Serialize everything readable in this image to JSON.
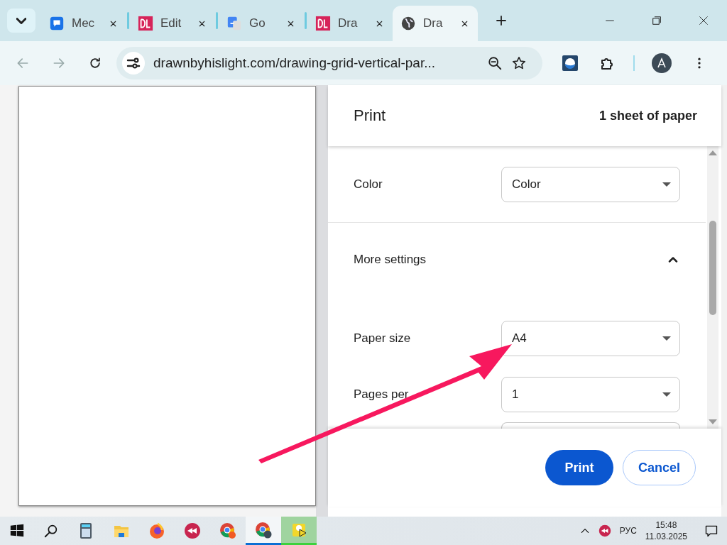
{
  "browser": {
    "tabs": [
      {
        "label": "Mec",
        "kind": "chat",
        "selected": false
      },
      {
        "label": "Edit",
        "kind": "dl",
        "selected": false
      },
      {
        "label": "Go",
        "kind": "translate",
        "selected": false
      },
      {
        "label": "Dra",
        "kind": "dl",
        "selected": false
      },
      {
        "label": "Dra",
        "kind": "globe",
        "selected": true
      }
    ],
    "address": "drawnbyhislight.com/drawing-grid-vertical-par..."
  },
  "print_dialog": {
    "title": "Print",
    "sheet_count": "1 sheet of paper",
    "settings": [
      {
        "kind": "select",
        "label": "Color",
        "value": "Color"
      },
      {
        "kind": "section",
        "label": "More settings",
        "expanded": true
      },
      {
        "kind": "select",
        "label": "Paper size",
        "value": "A4"
      },
      {
        "kind": "select",
        "label": "Pages per",
        "value": "1"
      },
      {
        "kind": "cut"
      }
    ],
    "buttons": [
      {
        "label": "Print",
        "kind": "primary"
      },
      {
        "label": "Cancel",
        "kind": "secondary"
      }
    ]
  },
  "taskbar": {
    "apps": [
      {
        "kind": "calculator",
        "selected": false
      },
      {
        "kind": "folder",
        "selected": false
      },
      {
        "kind": "firefox",
        "selected": false
      },
      {
        "kind": "redapp",
        "selected": false
      },
      {
        "kind": "chrome",
        "selected": false
      },
      {
        "kind": "chrome-profile",
        "selected": true
      },
      {
        "kind": "yellow",
        "selected": true
      }
    ],
    "language": "РУС",
    "time": "15:48",
    "date": "11.03.2025"
  }
}
